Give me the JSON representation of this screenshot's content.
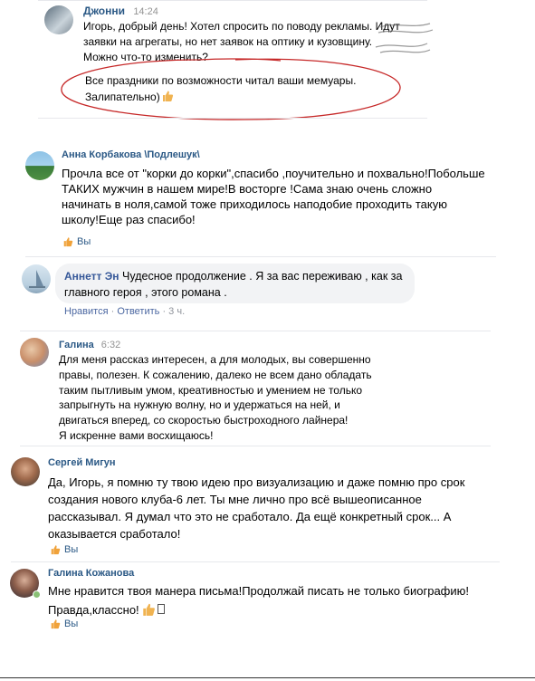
{
  "post1": {
    "author": "Джонни",
    "time": "14:24",
    "line1": "Игорь, добрый день! Хотел спросить по поводу рекламы. Идут",
    "line2": "заявки на агрегаты, но нет заявок на оптику и кузовщину.",
    "line3": "Можно что-то изменить?",
    "line4": "Все праздники по возможности читал ваши мемуары.",
    "line5": "Залипательно)"
  },
  "comment1": {
    "author": "Анна Корбакова \\Подлешук\\",
    "lines": [
      "Прочла все от \"корки до корки\",спасибо ,поучительно и похвально!Побольше",
      " ТАКИХ  мужчин в нашем мире!В восторге !Сама знаю очень сложно",
      "начинать в ноля,самой тоже приходилось наподобие проходить такую",
      "школу!Еще раз спасибо!"
    ],
    "like_label": "Вы"
  },
  "comment2": {
    "author": "Аннетт Эн",
    "line1": "Чудесное продолжение . Я за вас переживаю , как за",
    "line2": "главного героя , этого романа .",
    "like_link": "Нравится",
    "reply_link": "Ответить",
    "time": "3 ч."
  },
  "comment3": {
    "author": "Галина",
    "time": "6:32",
    "lines": [
      "Для меня рассказ интересен, а для молодых, вы совершенно",
      "правы, полезен. К сожалению, далеко не всем дано обладать",
      "таким пытливым умом, креативностью и умением не только",
      "запрыгнуть на нужную волну, но и удержаться на ней, и",
      "двигаться вперед, со скоростью быстроходного лайнера!",
      "Я искренне вами восхищаюсь!"
    ]
  },
  "comment4": {
    "author": "Сергей Мигун",
    "lines": [
      "Да,  Игорь, я помню ту твою идею про визуализацию и даже помню про срок",
      "создания нового клуба-6 лет.  Ты мне лично про всё вышеописанное",
      " рассказывал. Я думал что это не сработало. Да ещё конкретный срок... А",
      "оказывается сработало!"
    ],
    "like_label": "Вы"
  },
  "comment5": {
    "author": "Галина Кожанова",
    "line1": "Мне нравится твоя манера письма!Продолжай писать не только биографию!",
    "line2": "Правда,классно!",
    "like_label": "Вы"
  },
  "colors": {
    "link": "#2a5885",
    "fb_link": "#365899",
    "circle": "#c62828",
    "like_orange": "#f5a623"
  }
}
